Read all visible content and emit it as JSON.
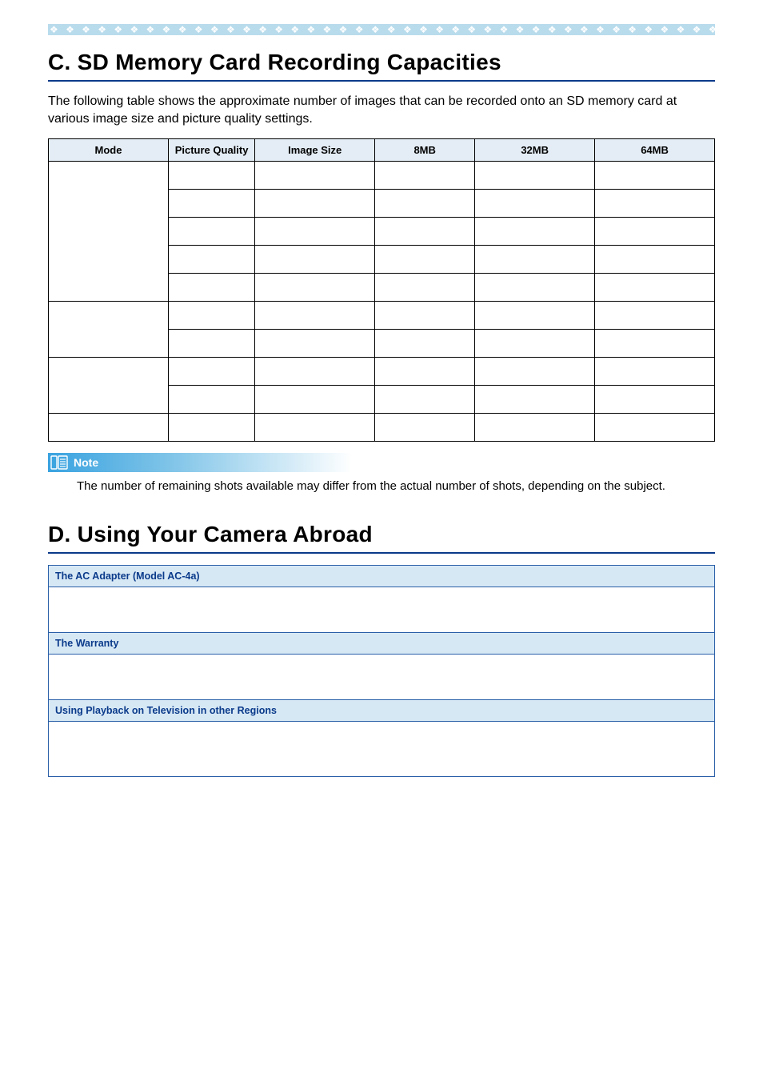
{
  "decor": {
    "diamonds": "❖ ❖ ❖ ❖ ❖ ❖ ❖ ❖ ❖ ❖ ❖ ❖ ❖ ❖ ❖ ❖ ❖ ❖ ❖ ❖ ❖ ❖ ❖ ❖ ❖ ❖ ❖ ❖ ❖ ❖ ❖ ❖ ❖ ❖ ❖ ❖ ❖ ❖ ❖ ❖ ❖ ❖ ❖ ❖ ❖ ❖ ❖ ❖ ❖ ❖ ❖ ❖ ❖ ❖ ❖ ❖ ❖ ❖"
  },
  "section_c": {
    "title": "C. SD Memory Card Recording Capacities",
    "intro": "The following table shows the approximate number of images that can be recorded onto an SD memory card at various image size and picture quality settings.",
    "table": {
      "headers": [
        "Mode",
        "Picture Quality",
        "Image Size",
        "8MB",
        "32MB",
        "64MB"
      ]
    },
    "note_label": "Note",
    "note_body": "The number of remaining shots available may differ from the actual number of shots, depending on the subject."
  },
  "section_d": {
    "title": "D. Using Your Camera Abroad",
    "rows": [
      "The AC Adapter (Model AC-4a)",
      "The Warranty",
      "Using Playback on Television in other Regions"
    ]
  }
}
